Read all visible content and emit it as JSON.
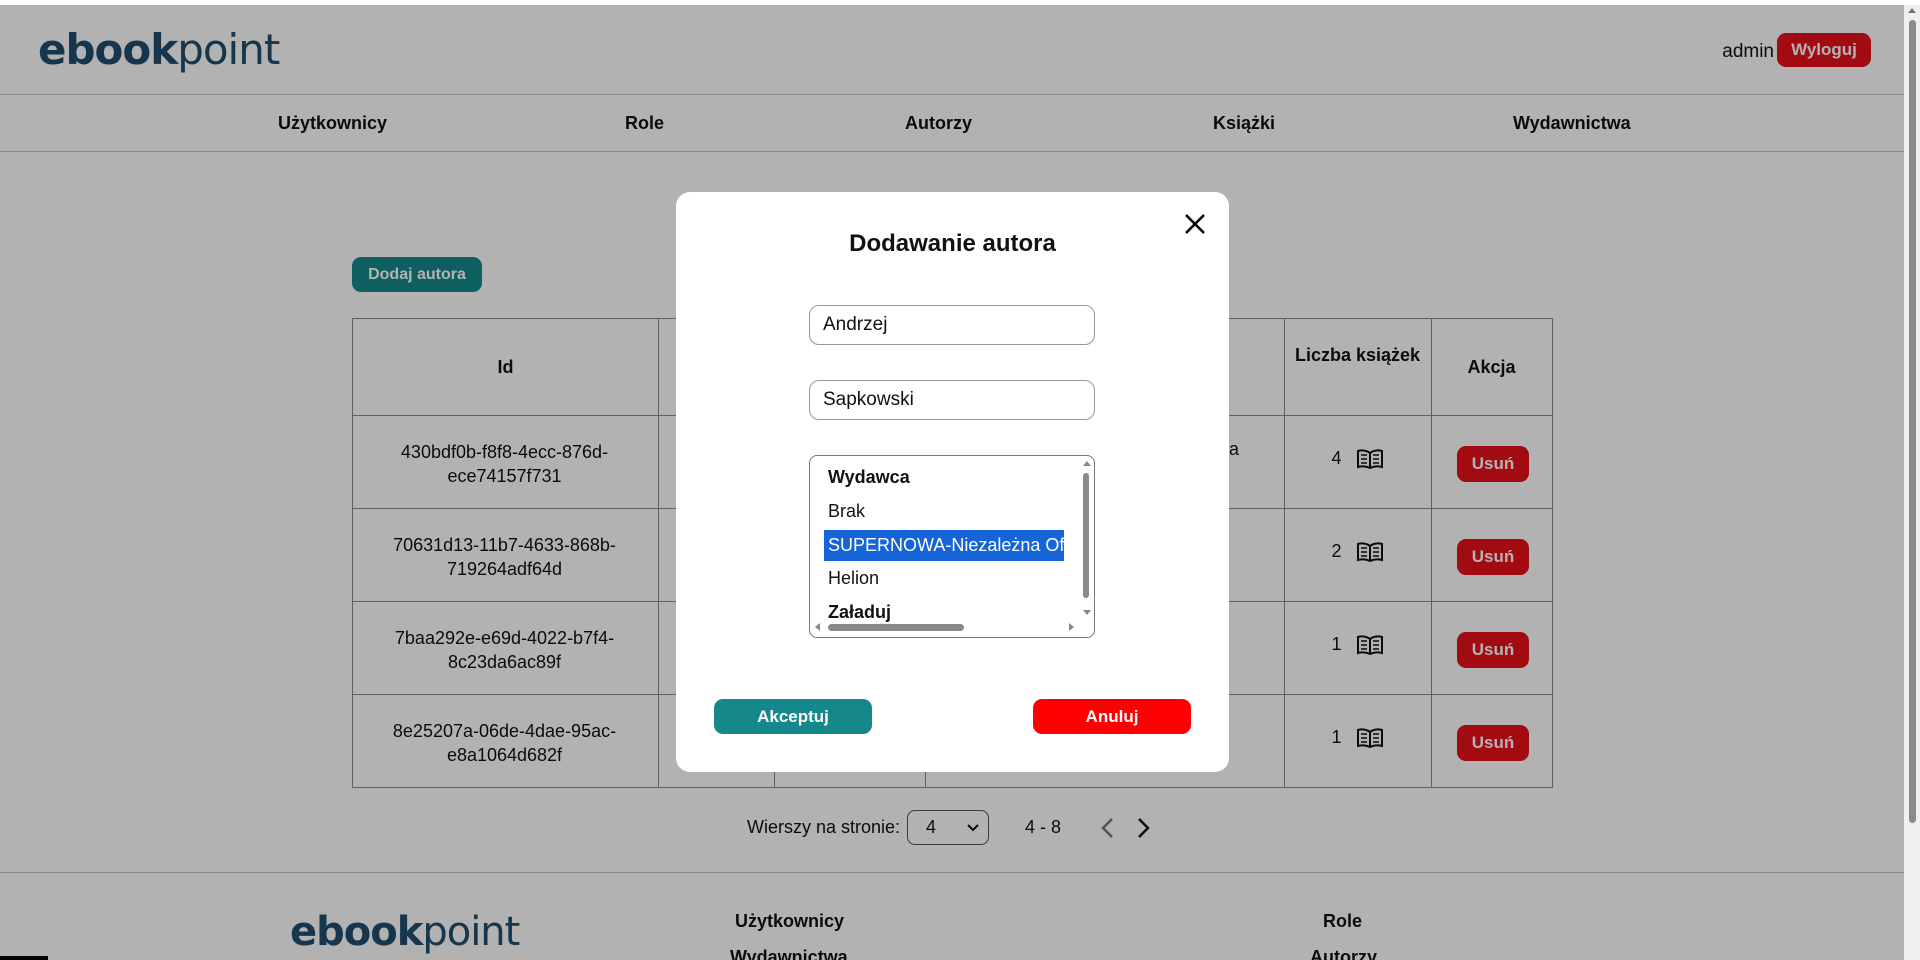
{
  "header": {
    "logo_main": "ebook",
    "logo_tail": "point",
    "username": "admin",
    "logout_label": "Wyloguj"
  },
  "nav": {
    "items": [
      {
        "label": "Użytkownicy"
      },
      {
        "label": "Role"
      },
      {
        "label": "Autorzy"
      },
      {
        "label": "Książki"
      },
      {
        "label": "Wydawnictwa"
      }
    ]
  },
  "main": {
    "add_author_label": "Dodaj autora",
    "table": {
      "headers": {
        "id": "Id",
        "book_count": "Liczba książek",
        "action": "Akcja"
      },
      "partial_first_row_text": "a",
      "rows": [
        {
          "id": "430bdf0b-f8f8-4ecc-876d-ece74157f731",
          "count": "4",
          "action": "Usuń"
        },
        {
          "id": "70631d13-11b7-4633-868b-719264adf64d",
          "count": "2",
          "action": "Usuń"
        },
        {
          "id": "7baa292e-e69d-4022-b7f4-8c23da6ac89f",
          "count": "1",
          "action": "Usuń"
        },
        {
          "id": "8e25207a-06de-4dae-95ac-e8a1064d682f",
          "count": "1",
          "action": "Usuń"
        }
      ]
    },
    "pagination": {
      "rows_label": "Wierszy na stronie:",
      "rows_per_page": "4",
      "range": "4 - 8"
    }
  },
  "footer": {
    "logo_main": "ebook",
    "logo_tail": "point",
    "links": [
      "Użytkownicy",
      "Role",
      "Wydawnictwa",
      "Autorzy"
    ]
  },
  "modal": {
    "title": "Dodawanie autora",
    "first_name_value": "Andrzej",
    "last_name_value": "Sapkowski",
    "publisher_options": [
      {
        "label": "Wydawca",
        "bold": true
      },
      {
        "label": "Brak"
      },
      {
        "label": "SUPERNOWA-Niezależna Of",
        "selected": true
      },
      {
        "label": "Helion"
      },
      {
        "label": "Załaduj",
        "bold": true
      }
    ],
    "accept_label": "Akceptuj",
    "cancel_label": "Anuluj"
  },
  "colors": {
    "brand_teal": "#14888a",
    "danger_red": "#e8101a",
    "cancel_red": "#ff0000",
    "selection_blue": "#1565d8",
    "logo_navy": "#1f4e6e"
  }
}
